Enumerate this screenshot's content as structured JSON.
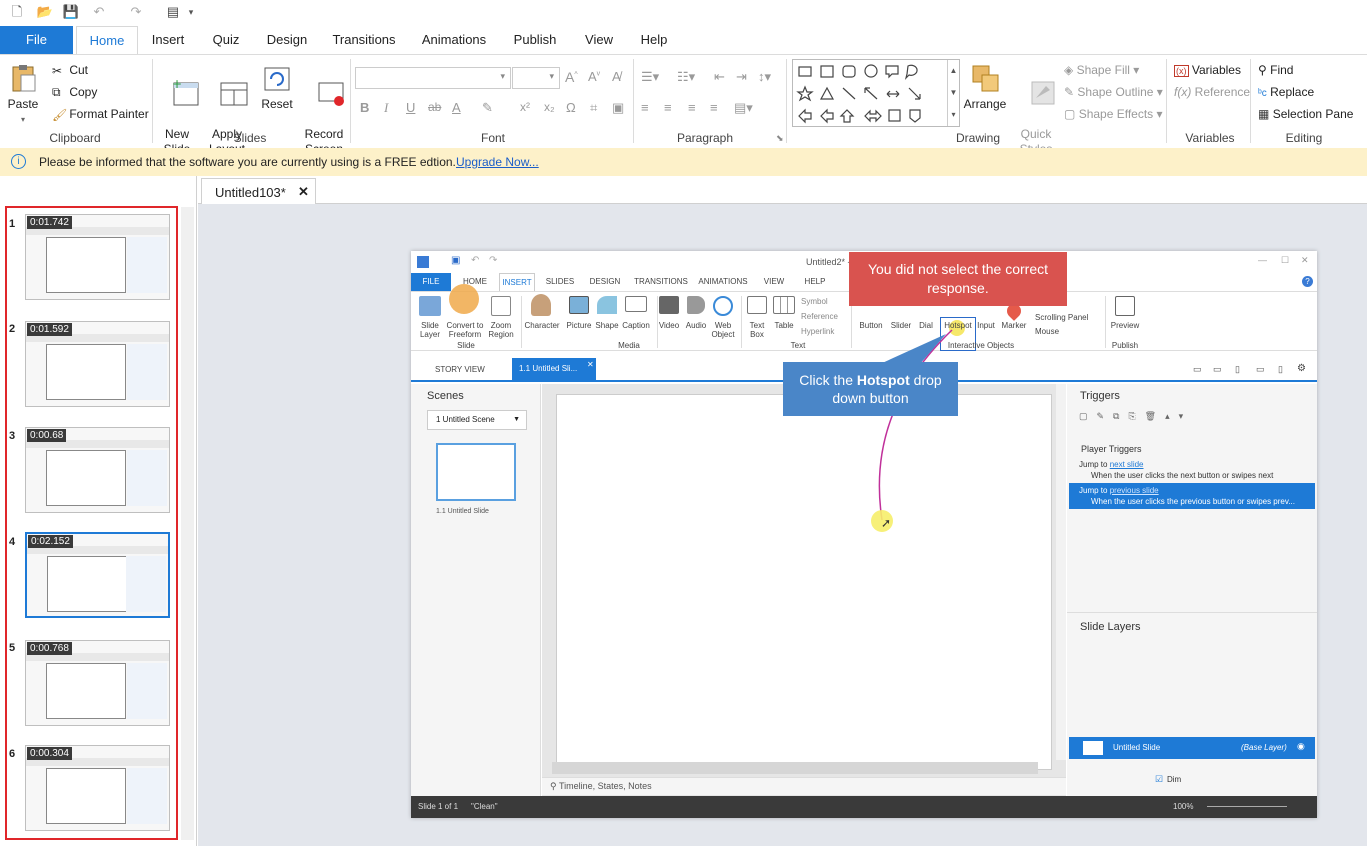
{
  "tabs": [
    {
      "label": "File"
    },
    {
      "label": "Home"
    },
    {
      "label": "Insert"
    },
    {
      "label": "Quiz"
    },
    {
      "label": "Design"
    },
    {
      "label": "Transitions"
    },
    {
      "label": "Animations"
    },
    {
      "label": "Publish"
    },
    {
      "label": "View"
    },
    {
      "label": "Help"
    }
  ],
  "clipboard": {
    "paste": "Paste",
    "cut": "Cut",
    "copy": "Copy",
    "format_painter": "Format Painter",
    "label": "Clipboard"
  },
  "slides": {
    "new_slide": "New\nSlide",
    "apply_layout": "Apply\nLayout",
    "reset": "Reset",
    "record_screen": "Record\nScreen",
    "label": "Slides"
  },
  "font": {
    "label": "Font"
  },
  "paragraph": {
    "label": "Paragraph"
  },
  "drawing": {
    "arrange": "Arrange",
    "quick_styles": "Quick\nStyles",
    "shape_fill": "Shape Fill",
    "shape_outline": "Shape Outline",
    "shape_effects": "Shape Effects",
    "label": "Drawing"
  },
  "variables": {
    "variables": "Variables",
    "reference": "Reference",
    "label": "Variables"
  },
  "editing": {
    "find": "Find",
    "replace": "Replace",
    "selection_pane": "Selection Pane",
    "label": "Editing"
  },
  "notice": {
    "message": "Please be informed that the software you are currently using is a FREE edtion.",
    "link": "Upgrade Now..."
  },
  "document_tab": {
    "title": "Untitled103*",
    "close": "✕"
  },
  "thumbnails": [
    {
      "num": "1",
      "time": "0:01.742"
    },
    {
      "num": "2",
      "time": "0:01.592"
    },
    {
      "num": "3",
      "time": "0:00.68"
    },
    {
      "num": "4",
      "time": "0:02.152"
    },
    {
      "num": "5",
      "time": "0:00.768"
    },
    {
      "num": "6",
      "time": "0:00.304"
    }
  ],
  "inner": {
    "title": "Untitled2* -",
    "tabs": [
      "FILE",
      "HOME",
      "INSERT",
      "SLIDES",
      "DESIGN",
      "TRANSITIONS",
      "ANIMATIONS",
      "VIEW",
      "HELP"
    ],
    "ribbon": {
      "slide_layer": "Slide\nLayer",
      "convert_freeform": "Convert to\nFreeform",
      "zoom_region": "Zoom\nRegion",
      "slide_group": "Slide",
      "character": "Character",
      "picture": "Picture",
      "shape": "Shape",
      "caption": "Caption",
      "video": "Video",
      "audio": "Audio",
      "web_object": "Web\nObject",
      "media_group": "Media",
      "text_box": "Text\nBox",
      "table": "Table",
      "symbol": "Symbol",
      "reference": "Reference",
      "hyperlink": "Hyperlink",
      "text_group": "Text",
      "button": "Button",
      "slider": "Slider",
      "dial": "Dial",
      "hotspot": "Hotspot",
      "input": "Input",
      "marker": "Marker",
      "scrolling_panel": "Scrolling Panel",
      "mouse": "Mouse",
      "interactive_group": "Interactive Objects",
      "preview": "Preview",
      "publish_group": "Publish"
    },
    "story_view": "STORY VIEW",
    "slide_tab": "1.1 Untitled Sli...",
    "scenes_title": "Scenes",
    "scene_select": "1 Untitled Scene",
    "scene_slide_label": "1.1 Untitled Slide",
    "triggers_title": "Triggers",
    "player_triggers": "Player Triggers",
    "trigger1_prefix": "Jump to",
    "trigger1_link": "next slide",
    "trigger1_desc": "When the user clicks the next button or swipes next",
    "trigger2_prefix": "Jump to",
    "trigger2_link": "previous slide",
    "trigger2_desc": "When the user clicks the previous button or swipes prev...",
    "slide_layers_title": "Slide Layers",
    "base_layer_name": "Untitled Slide",
    "base_layer_tag": "(Base Layer)",
    "dim_label": "Dim",
    "timeline_label": "Timeline, States, Notes",
    "status_slide": "Slide 1 of 1",
    "status_theme": "\"Clean\"",
    "zoom": "100%"
  },
  "callouts": {
    "red": "You did not select the correct response.",
    "blue_pre": "Click the ",
    "blue_bold": "Hotspot",
    "blue_post": " drop down button"
  },
  "colors": {
    "accent": "#1e7ad6",
    "callout_red": "#d9534f",
    "callout_blue": "#4a86c8",
    "notice_bg": "#fdf1c9",
    "frame_red": "#e0262a"
  }
}
